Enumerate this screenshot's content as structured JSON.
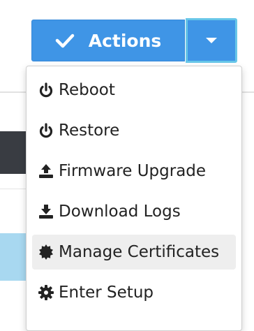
{
  "colors": {
    "primary": "#3f95e6",
    "focus_ring": "#67c6e8",
    "menu_text": "#222222",
    "active_bg": "#eeeeee"
  },
  "actions_button": {
    "label": "Actions",
    "icon": "check-icon"
  },
  "dropdown_toggle": {
    "icon": "caret-down-icon"
  },
  "menu": {
    "items": [
      {
        "label": "Reboot",
        "icon": "power-icon"
      },
      {
        "label": "Restore",
        "icon": "power-icon"
      },
      {
        "label": "Firmware Upgrade",
        "icon": "upload-icon"
      },
      {
        "label": "Download Logs",
        "icon": "download-icon"
      },
      {
        "label": "Manage Certificates",
        "icon": "certificate-icon",
        "active": true
      },
      {
        "label": "Enter Setup",
        "icon": "gear-icon"
      }
    ]
  }
}
